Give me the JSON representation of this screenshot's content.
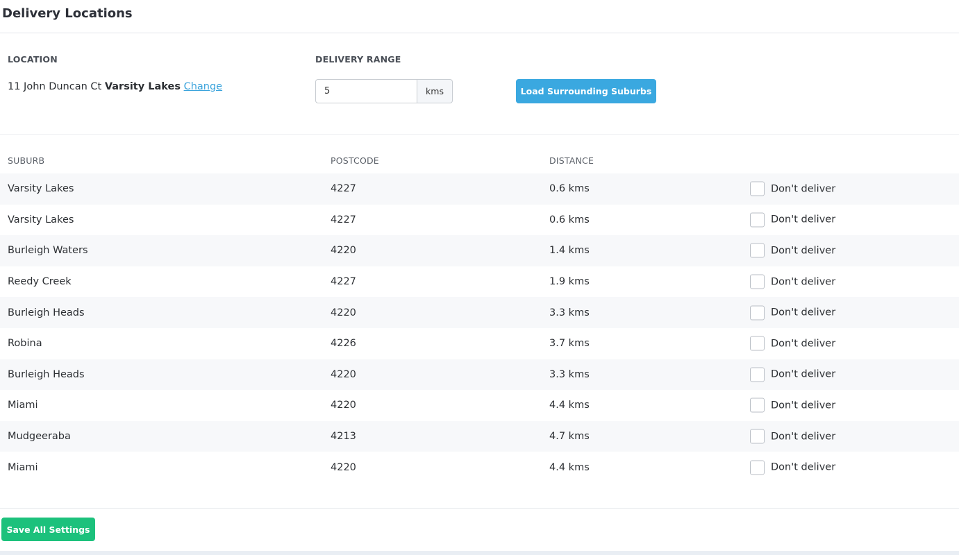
{
  "page": {
    "title": "Delivery Locations"
  },
  "location": {
    "label": "LOCATION",
    "street": "11 John Duncan Ct",
    "suburb": "Varsity Lakes",
    "change_label": "Change"
  },
  "range": {
    "label": "DELIVERY RANGE",
    "value": "5",
    "unit": "kms"
  },
  "load_button_label": "Load Surrounding Suburbs",
  "table": {
    "headers": {
      "suburb": "SUBURB",
      "postcode": "POSTCODE",
      "distance": "DISTANCE"
    },
    "checkbox_label": "Don't deliver",
    "rows": [
      {
        "suburb": "Varsity Lakes",
        "postcode": "4227",
        "distance": "0.6 kms",
        "dont_deliver": false
      },
      {
        "suburb": "Varsity Lakes",
        "postcode": "4227",
        "distance": "0.6 kms",
        "dont_deliver": false
      },
      {
        "suburb": "Burleigh Waters",
        "postcode": "4220",
        "distance": "1.4 kms",
        "dont_deliver": false
      },
      {
        "suburb": "Reedy Creek",
        "postcode": "4227",
        "distance": "1.9 kms",
        "dont_deliver": false
      },
      {
        "suburb": "Burleigh Heads",
        "postcode": "4220",
        "distance": "3.3 kms",
        "dont_deliver": false
      },
      {
        "suburb": "Robina",
        "postcode": "4226",
        "distance": "3.7 kms",
        "dont_deliver": false
      },
      {
        "suburb": "Burleigh Heads",
        "postcode": "4220",
        "distance": "3.3 kms",
        "dont_deliver": false
      },
      {
        "suburb": "Miami",
        "postcode": "4220",
        "distance": "4.4 kms",
        "dont_deliver": false
      },
      {
        "suburb": "Mudgeeraba",
        "postcode": "4213",
        "distance": "4.7 kms",
        "dont_deliver": false
      },
      {
        "suburb": "Miami",
        "postcode": "4220",
        "distance": "4.4 kms",
        "dont_deliver": false
      }
    ]
  },
  "save_button_label": "Save All Settings",
  "colors": {
    "link": "#3aa3dc",
    "load_button": "#3aa8e0",
    "save_button": "#1cc17c",
    "row_stripe": "#f7f8fa"
  }
}
